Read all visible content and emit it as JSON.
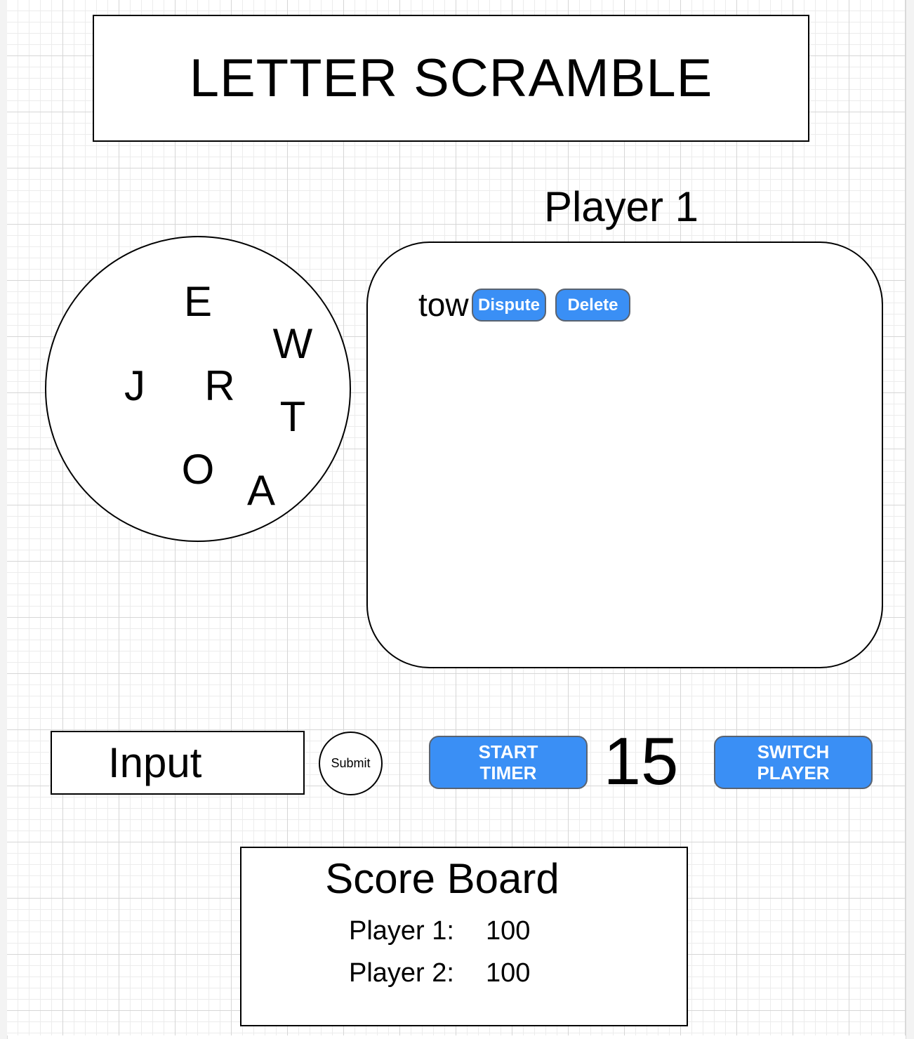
{
  "header": {
    "title": "LETTER SCRAMBLE"
  },
  "player": {
    "current_label": "Player 1"
  },
  "letters": [
    "E",
    "W",
    "J",
    "R",
    "T",
    "O",
    "A"
  ],
  "words_panel": {
    "entries": [
      {
        "word": "tow",
        "dispute_label": "Dispute",
        "delete_label": "Delete"
      }
    ]
  },
  "controls": {
    "input_placeholder": "Input",
    "submit_label": "Submit",
    "start_timer_label_line1": "START",
    "start_timer_label_line2": "TIMER",
    "timer_value": "15",
    "switch_player_label_line1": "SWITCH",
    "switch_player_label_line2": "PLAYER"
  },
  "scoreboard": {
    "title": "Score Board",
    "rows": [
      {
        "name": "Player 1:",
        "score": "100"
      },
      {
        "name": "Player 2:",
        "score": "100"
      }
    ]
  },
  "colors": {
    "button_fill": "#3a8ff5",
    "button_border": "#5a6370",
    "grid_major": "#d6d6d6",
    "grid_minor": "#ececec"
  }
}
